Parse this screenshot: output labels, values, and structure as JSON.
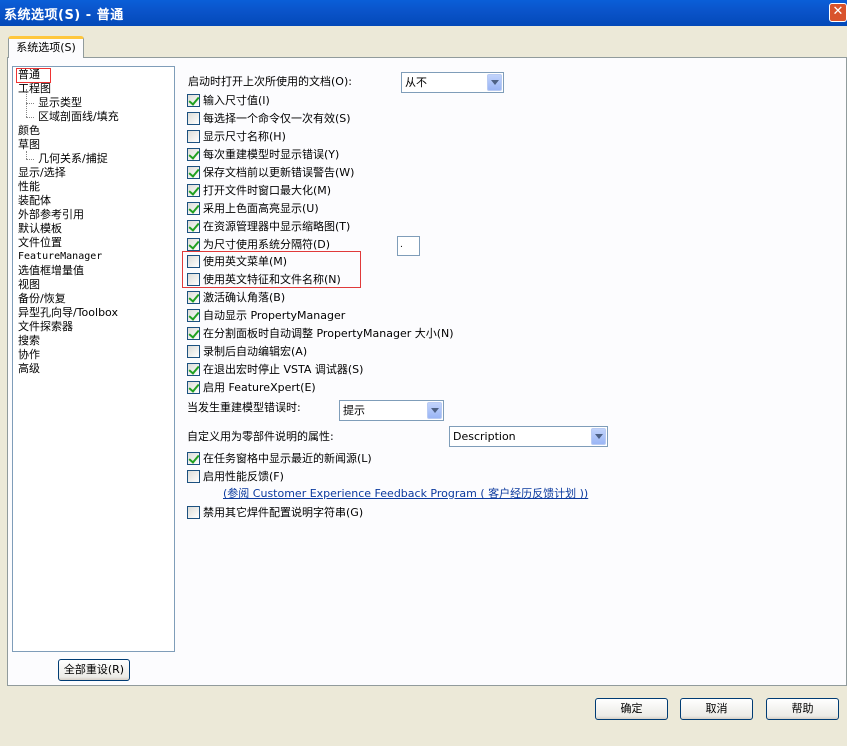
{
  "window": {
    "title": "系统选项(S) - 普通"
  },
  "tab": {
    "label": "系统选项(S)"
  },
  "tree": {
    "items": [
      "普通",
      "工程图",
      "显示类型",
      "区域剖面线/填充",
      "颜色",
      "草图",
      "几何关系/捕捉",
      "显示/选择",
      "性能",
      "装配体",
      "外部参考引用",
      "默认模板",
      "文件位置",
      "FeatureManager",
      "选值框增量值",
      "视图",
      "备份/恢复",
      "异型孔向导/Toolbox",
      "文件探索器",
      "搜索",
      "协作",
      "高级"
    ]
  },
  "reset_button": "全部重设(R)",
  "options": {
    "reopen_label": "启动时打开上次所使用的文档(O):",
    "reopen_value": "从不",
    "rebuild_error_label": "当发生重建模型错误时:",
    "rebuild_error_value": "提示",
    "custom_prop_label": "自定义用为零部件说明的属性:",
    "custom_prop_value": "Description",
    "small_field_value": ".",
    "feedback_link": "(参阅 Customer Experience Feedback Program ( 客户经历反馈计划 ))",
    "checkboxes": [
      {
        "label": "输入尺寸值(I)",
        "checked": true
      },
      {
        "label": "每选择一个命令仅一次有效(S)",
        "checked": false
      },
      {
        "label": "显示尺寸名称(H)",
        "checked": false
      },
      {
        "label": "每次重建模型时显示错误(Y)",
        "checked": true
      },
      {
        "label": "保存文档前以更新错误警告(W)",
        "checked": true
      },
      {
        "label": "打开文件时窗口最大化(M)",
        "checked": true
      },
      {
        "label": "采用上色面高亮显示(U)",
        "checked": true
      },
      {
        "label": "在资源管理器中显示缩略图(T)",
        "checked": true
      },
      {
        "label": "为尺寸使用系统分隔符(D)",
        "checked": true
      },
      {
        "label": "使用英文菜单(M)",
        "checked": false
      },
      {
        "label": "使用英文特征和文件名称(N)",
        "checked": false
      },
      {
        "label": "激活确认角落(B)",
        "checked": true
      },
      {
        "label": "自动显示 PropertyManager",
        "checked": true
      },
      {
        "label": "在分割面板时自动调整 PropertyManager 大小(N)",
        "checked": true
      },
      {
        "label": "录制后自动编辑宏(A)",
        "checked": false
      },
      {
        "label": "在退出宏时停止 VSTA 调试器(S)",
        "checked": true
      },
      {
        "label": "启用 FeatureXpert(E)",
        "checked": true
      },
      {
        "label": "在任务窗格中显示最近的新闻源(L)",
        "checked": true
      },
      {
        "label": "启用性能反馈(F)",
        "checked": false
      },
      {
        "label": "禁用其它焊件配置说明字符串(G)",
        "checked": false
      }
    ]
  },
  "buttons": {
    "ok": "确定",
    "cancel": "取消",
    "help": "帮助"
  }
}
